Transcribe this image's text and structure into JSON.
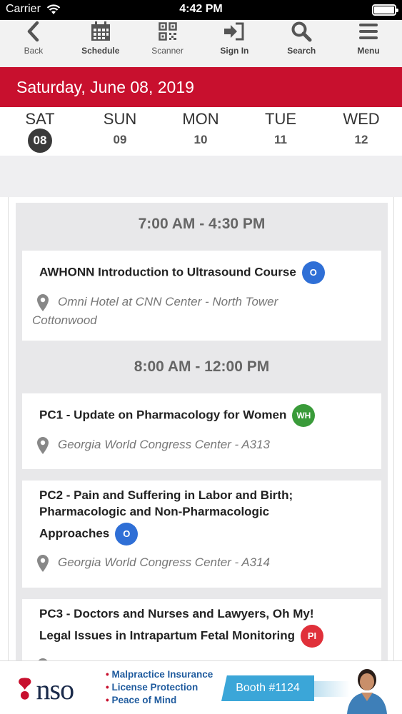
{
  "status": {
    "carrier": "Carrier",
    "time": "4:42 PM"
  },
  "toolbar": {
    "back": "Back",
    "schedule": "Schedule",
    "scanner": "Scanner",
    "sign_in": "Sign In",
    "search": "Search",
    "menu": "Menu"
  },
  "date_banner": "Saturday, June 08, 2019",
  "days": [
    {
      "name": "SAT",
      "num": "08"
    },
    {
      "name": "SUN",
      "num": "09"
    },
    {
      "name": "MON",
      "num": "10"
    },
    {
      "name": "TUE",
      "num": "11"
    },
    {
      "name": "WED",
      "num": "12"
    }
  ],
  "schedule": {
    "slot1_time": "7:00 AM - 4:30 PM",
    "slot2_time": "8:00 AM - 12:00 PM",
    "sessions": [
      {
        "title": "AWHONN Introduction to Ultrasound Course",
        "badge": "O",
        "badge_color": "#2f6fd6",
        "location_line1": "Omni Hotel at CNN Center - North Tower",
        "location_line2": "Cottonwood"
      },
      {
        "title": "PC1 - Update on Pharmacology for Women",
        "badge": "WH",
        "badge_color": "#3a9b3a",
        "location": "Georgia World Congress Center - A313"
      },
      {
        "title_line1": "PC2 - Pain and Suffering in Labor and Birth;",
        "title_line2": "Pharmacologic and Non-Pharmacologic",
        "title_line3": "Approaches",
        "badge": "O",
        "badge_color": "#2f6fd6",
        "location": "Georgia World Congress Center - A314"
      },
      {
        "title_line1": "PC3 - Doctors and Nurses and Lawyers, Oh My!",
        "title_line2": "Legal Issues in Intrapartum Fetal Monitoring",
        "badge": "PI",
        "badge_color": "#e0303a"
      }
    ]
  },
  "ad": {
    "logo": "nso",
    "items": [
      "Malpractice Insurance",
      "License Protection",
      "Peace of Mind"
    ],
    "booth": "Booth #1124"
  }
}
